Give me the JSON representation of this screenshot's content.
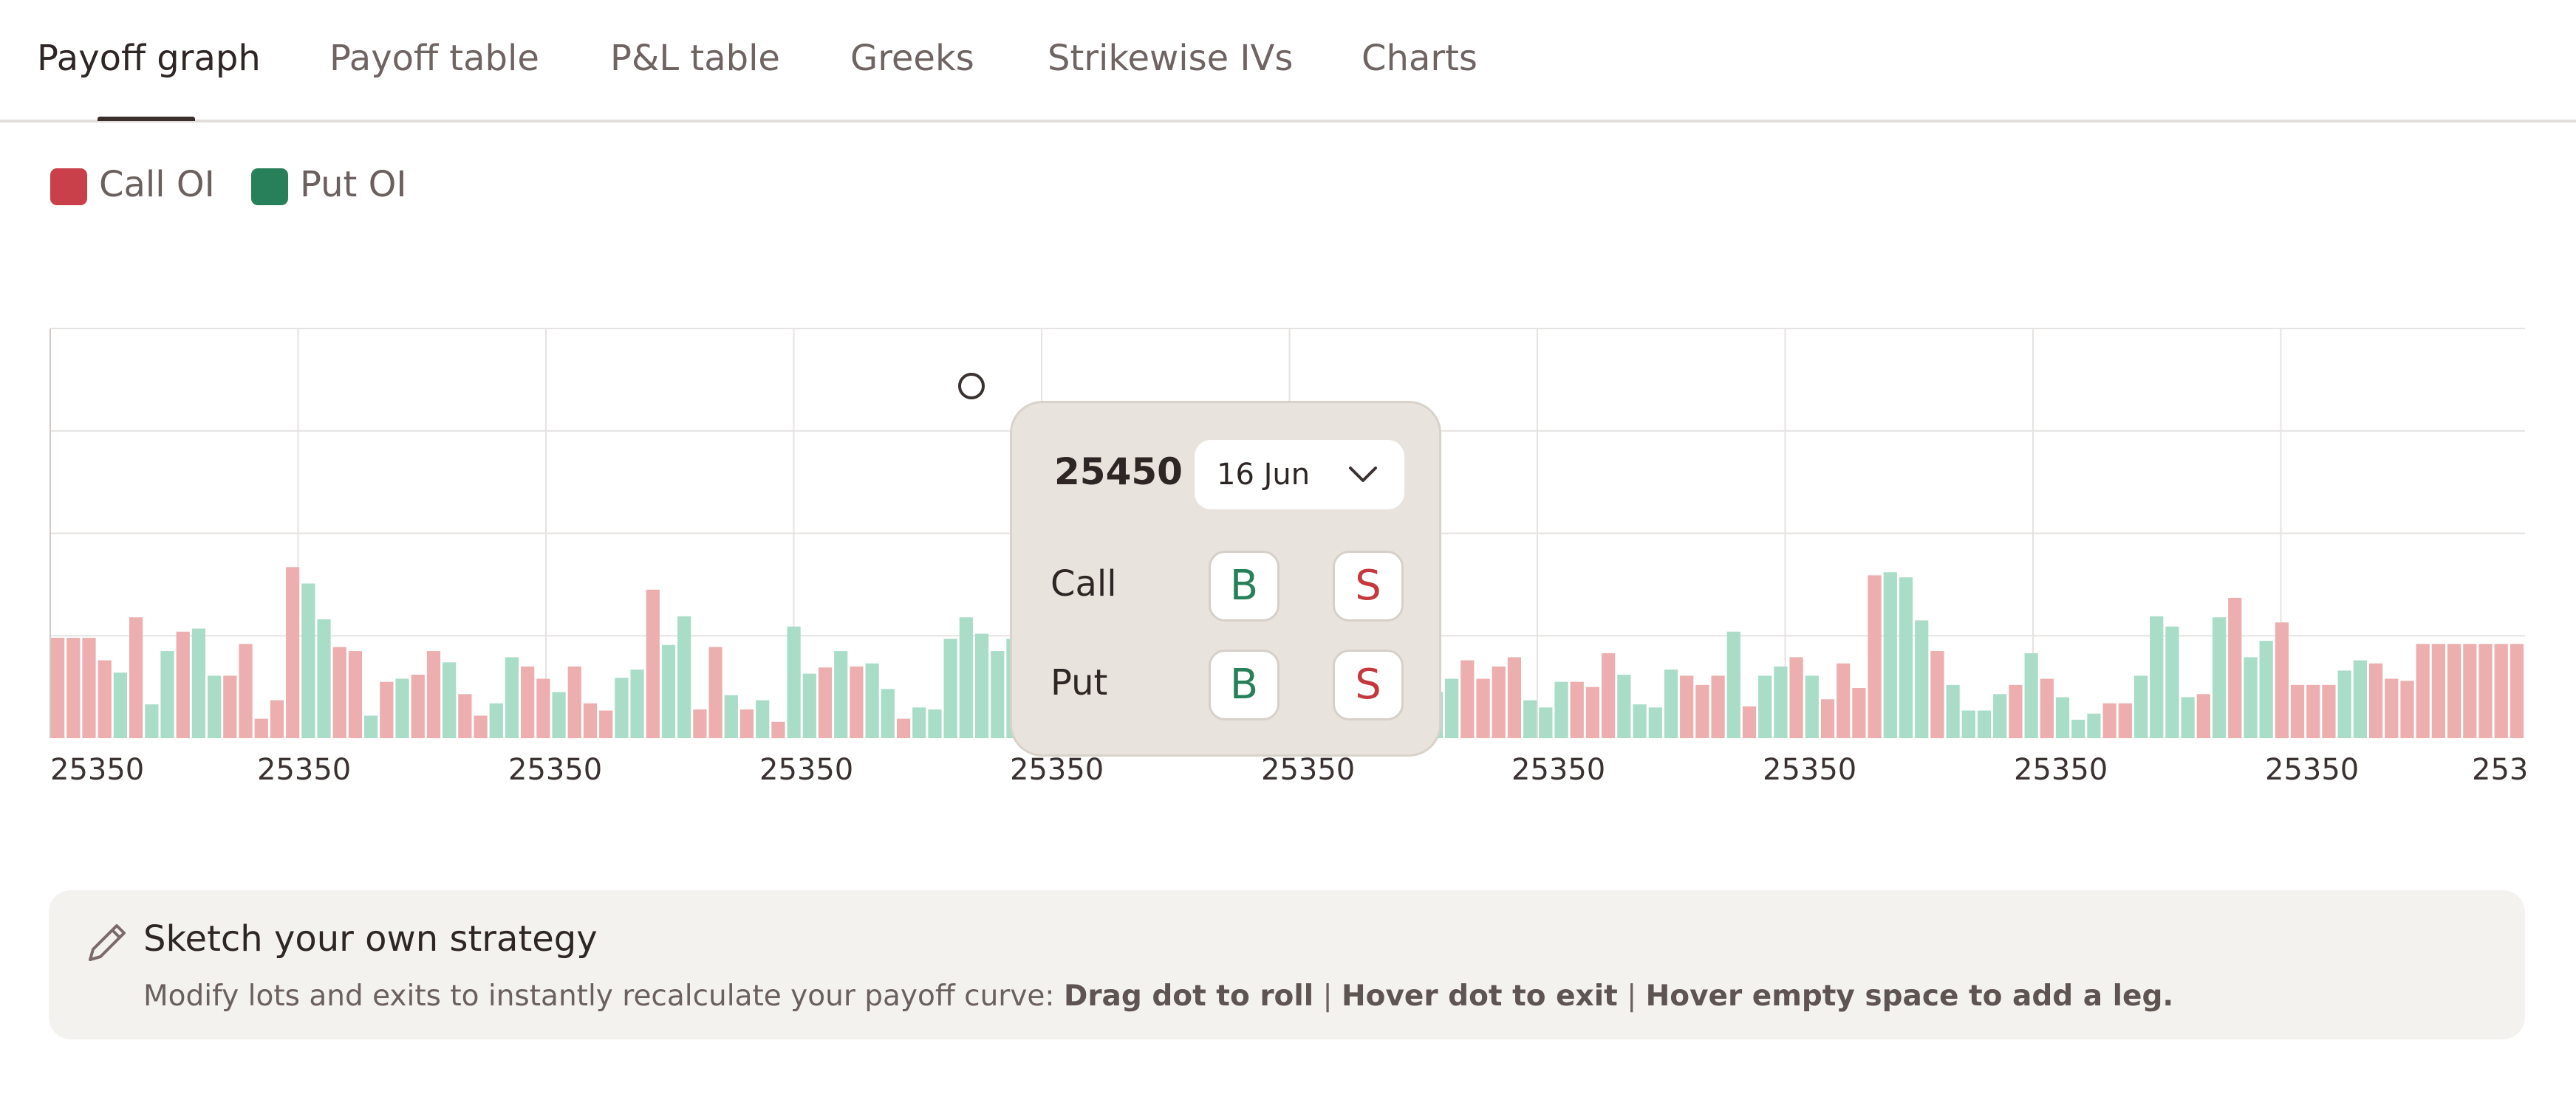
{
  "tabs": [
    {
      "label": "Payoff graph",
      "active": true
    },
    {
      "label": "Payoff table",
      "active": false
    },
    {
      "label": "P&L table",
      "active": false
    },
    {
      "label": "Greeks",
      "active": false
    },
    {
      "label": "Strikewise IVs",
      "active": false
    },
    {
      "label": "Charts",
      "active": false
    }
  ],
  "legend": [
    {
      "label": "Call OI",
      "color": "#c9404a"
    },
    {
      "label": "Put OI",
      "color": "#27805a"
    }
  ],
  "chart_data": {
    "type": "bar",
    "x_tick_labels": [
      "25350",
      "25350",
      "25350",
      "25350",
      "25350",
      "25350",
      "25350",
      "25350",
      "25350",
      "25350",
      "253"
    ],
    "series": [
      {
        "name": "Call OI",
        "color": "#ecaeae"
      },
      {
        "name": "Put OI",
        "color": "#a9ddc8"
      }
    ],
    "ylim": [
      0,
      4
    ],
    "grid": true,
    "bars": [
      {
        "s": "call",
        "v": 0.98
      },
      {
        "s": "call",
        "v": 0.98
      },
      {
        "s": "call",
        "v": 0.98
      },
      {
        "s": "call",
        "v": 0.76
      },
      {
        "s": "put",
        "v": 0.64
      },
      {
        "s": "call",
        "v": 1.18
      },
      {
        "s": "put",
        "v": 0.33
      },
      {
        "s": "put",
        "v": 0.85
      },
      {
        "s": "call",
        "v": 1.04
      },
      {
        "s": "put",
        "v": 1.07
      },
      {
        "s": "put",
        "v": 0.61
      },
      {
        "s": "call",
        "v": 0.61
      },
      {
        "s": "call",
        "v": 0.92
      },
      {
        "s": "call",
        "v": 0.19
      },
      {
        "s": "call",
        "v": 0.37
      },
      {
        "s": "call",
        "v": 1.67
      },
      {
        "s": "put",
        "v": 1.51
      },
      {
        "s": "put",
        "v": 1.16
      },
      {
        "s": "call",
        "v": 0.89
      },
      {
        "s": "call",
        "v": 0.85
      },
      {
        "s": "put",
        "v": 0.22
      },
      {
        "s": "call",
        "v": 0.55
      },
      {
        "s": "put",
        "v": 0.58
      },
      {
        "s": "call",
        "v": 0.62
      },
      {
        "s": "call",
        "v": 0.85
      },
      {
        "s": "put",
        "v": 0.74
      },
      {
        "s": "call",
        "v": 0.43
      },
      {
        "s": "call",
        "v": 0.22
      },
      {
        "s": "put",
        "v": 0.34
      },
      {
        "s": "put",
        "v": 0.79
      },
      {
        "s": "call",
        "v": 0.7
      },
      {
        "s": "call",
        "v": 0.58
      },
      {
        "s": "put",
        "v": 0.45
      },
      {
        "s": "call",
        "v": 0.7
      },
      {
        "s": "call",
        "v": 0.34
      },
      {
        "s": "call",
        "v": 0.27
      },
      {
        "s": "put",
        "v": 0.59
      },
      {
        "s": "put",
        "v": 0.67
      },
      {
        "s": "call",
        "v": 1.45
      },
      {
        "s": "put",
        "v": 0.91
      },
      {
        "s": "put",
        "v": 1.19
      },
      {
        "s": "call",
        "v": 0.28
      },
      {
        "s": "call",
        "v": 0.89
      },
      {
        "s": "put",
        "v": 0.42
      },
      {
        "s": "call",
        "v": 0.28
      },
      {
        "s": "put",
        "v": 0.37
      },
      {
        "s": "call",
        "v": 0.16
      },
      {
        "s": "put",
        "v": 1.09
      },
      {
        "s": "put",
        "v": 0.63
      },
      {
        "s": "call",
        "v": 0.69
      },
      {
        "s": "put",
        "v": 0.85
      },
      {
        "s": "call",
        "v": 0.7
      },
      {
        "s": "put",
        "v": 0.73
      },
      {
        "s": "put",
        "v": 0.48
      },
      {
        "s": "call",
        "v": 0.19
      },
      {
        "s": "put",
        "v": 0.3
      },
      {
        "s": "put",
        "v": 0.28
      },
      {
        "s": "put",
        "v": 0.97
      },
      {
        "s": "put",
        "v": 1.18
      },
      {
        "s": "put",
        "v": 1.02
      },
      {
        "s": "put",
        "v": 0.85
      },
      {
        "s": "put",
        "v": 0.97
      },
      {
        "s": "put",
        "v": 0.9
      },
      {
        "s": "put",
        "v": 0.84
      },
      {
        "s": "put",
        "v": 0.78
      },
      {
        "s": "put",
        "v": 0.72
      },
      {
        "s": "put",
        "v": 0.68
      },
      {
        "s": "put",
        "v": 0.74
      },
      {
        "s": "put",
        "v": 0.8
      },
      {
        "s": "put",
        "v": 0.86
      },
      {
        "s": "put",
        "v": 0.8
      },
      {
        "s": "put",
        "v": 0.74
      },
      {
        "s": "put",
        "v": 0.68
      },
      {
        "s": "put",
        "v": 0.74
      },
      {
        "s": "put",
        "v": 0.8
      },
      {
        "s": "put",
        "v": 0.86
      },
      {
        "s": "put",
        "v": 0.8
      },
      {
        "s": "put",
        "v": 0.74
      },
      {
        "s": "put",
        "v": 0.68
      },
      {
        "s": "put",
        "v": 0.74
      },
      {
        "s": "put",
        "v": 0.8
      },
      {
        "s": "put",
        "v": 0.86
      },
      {
        "s": "put",
        "v": 0.8
      },
      {
        "s": "put",
        "v": 0.74
      },
      {
        "s": "put",
        "v": 0.68
      },
      {
        "s": "put",
        "v": 0.74
      },
      {
        "s": "put",
        "v": 0.82
      },
      {
        "s": "put",
        "v": 0.4
      },
      {
        "s": "put",
        "v": 0.45
      },
      {
        "s": "put",
        "v": 0.58
      },
      {
        "s": "call",
        "v": 0.76
      },
      {
        "s": "call",
        "v": 0.58
      },
      {
        "s": "call",
        "v": 0.7
      },
      {
        "s": "call",
        "v": 0.79
      },
      {
        "s": "put",
        "v": 0.37
      },
      {
        "s": "put",
        "v": 0.3
      },
      {
        "s": "put",
        "v": 0.55
      },
      {
        "s": "call",
        "v": 0.55
      },
      {
        "s": "call",
        "v": 0.5
      },
      {
        "s": "call",
        "v": 0.83
      },
      {
        "s": "put",
        "v": 0.62
      },
      {
        "s": "put",
        "v": 0.33
      },
      {
        "s": "put",
        "v": 0.3
      },
      {
        "s": "put",
        "v": 0.67
      },
      {
        "s": "call",
        "v": 0.61
      },
      {
        "s": "call",
        "v": 0.52
      },
      {
        "s": "call",
        "v": 0.61
      },
      {
        "s": "put",
        "v": 1.04
      },
      {
        "s": "call",
        "v": 0.31
      },
      {
        "s": "put",
        "v": 0.61
      },
      {
        "s": "put",
        "v": 0.7
      },
      {
        "s": "call",
        "v": 0.79
      },
      {
        "s": "put",
        "v": 0.61
      },
      {
        "s": "call",
        "v": 0.38
      },
      {
        "s": "call",
        "v": 0.73
      },
      {
        "s": "call",
        "v": 0.49
      },
      {
        "s": "call",
        "v": 1.59
      },
      {
        "s": "put",
        "v": 1.62
      },
      {
        "s": "put",
        "v": 1.57
      },
      {
        "s": "put",
        "v": 1.15
      },
      {
        "s": "call",
        "v": 0.85
      },
      {
        "s": "put",
        "v": 0.52
      },
      {
        "s": "put",
        "v": 0.27
      },
      {
        "s": "put",
        "v": 0.27
      },
      {
        "s": "put",
        "v": 0.43
      },
      {
        "s": "call",
        "v": 0.52
      },
      {
        "s": "put",
        "v": 0.83
      },
      {
        "s": "call",
        "v": 0.58
      },
      {
        "s": "put",
        "v": 0.4
      },
      {
        "s": "put",
        "v": 0.18
      },
      {
        "s": "put",
        "v": 0.24
      },
      {
        "s": "call",
        "v": 0.34
      },
      {
        "s": "call",
        "v": 0.34
      },
      {
        "s": "put",
        "v": 0.61
      },
      {
        "s": "put",
        "v": 1.19
      },
      {
        "s": "put",
        "v": 1.09
      },
      {
        "s": "put",
        "v": 0.4
      },
      {
        "s": "call",
        "v": 0.43
      },
      {
        "s": "put",
        "v": 1.18
      },
      {
        "s": "call",
        "v": 1.37
      },
      {
        "s": "put",
        "v": 0.79
      },
      {
        "s": "put",
        "v": 0.95
      },
      {
        "s": "call",
        "v": 1.13
      },
      {
        "s": "call",
        "v": 0.52
      },
      {
        "s": "call",
        "v": 0.52
      },
      {
        "s": "call",
        "v": 0.52
      },
      {
        "s": "put",
        "v": 0.66
      },
      {
        "s": "put",
        "v": 0.76
      },
      {
        "s": "call",
        "v": 0.73
      },
      {
        "s": "call",
        "v": 0.58
      },
      {
        "s": "call",
        "v": 0.56
      },
      {
        "s": "call",
        "v": 0.92
      },
      {
        "s": "call",
        "v": 0.92
      },
      {
        "s": "call",
        "v": 0.92
      },
      {
        "s": "call",
        "v": 0.92
      },
      {
        "s": "call",
        "v": 0.92
      },
      {
        "s": "call",
        "v": 0.92
      },
      {
        "s": "call",
        "v": 0.92
      }
    ]
  },
  "popup": {
    "strike": "25450",
    "expiry": "16 Jun",
    "rows": [
      {
        "label": "Call",
        "buy": "B",
        "sell": "S"
      },
      {
        "label": "Put",
        "buy": "B",
        "sell": "S"
      }
    ]
  },
  "banner": {
    "icon": "pencil-icon",
    "title": "Sketch your own strategy",
    "desc_prefix": "Modify lots and exits to instantly recalculate your payoff curve: ",
    "hint_drag": "Drag dot to roll",
    "sep": " | ",
    "hint_hover_dot": "Hover dot to exit",
    "hint_hover_empty": "Hover empty space to add a leg."
  }
}
